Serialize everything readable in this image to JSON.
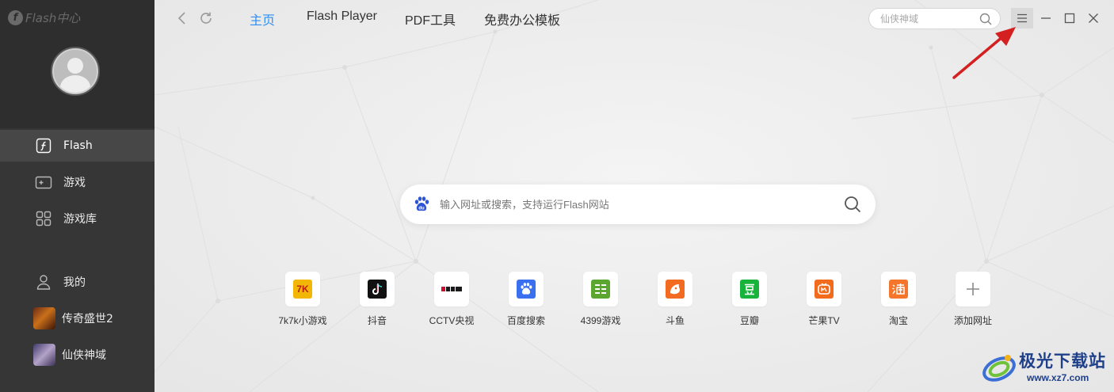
{
  "sidebar": {
    "logo_text": "Flash中心",
    "nav": [
      {
        "label": "Flash",
        "icon": "flash-icon",
        "active": true
      },
      {
        "label": "游戏",
        "icon": "gamepad-icon",
        "active": false
      },
      {
        "label": "游戏库",
        "icon": "grid-icon",
        "active": false
      }
    ],
    "mine": {
      "label": "我的",
      "icon": "user-icon"
    },
    "recent_games": [
      {
        "label": "传奇盛世2",
        "icon": "game-thumb-icon"
      },
      {
        "label": "仙侠神域",
        "icon": "game-thumb-icon"
      }
    ]
  },
  "topbar": {
    "tabs": [
      {
        "label": "主页",
        "active": true
      },
      {
        "label": "Flash Player",
        "active": false
      },
      {
        "label": "PDF工具",
        "active": false
      },
      {
        "label": "免费办公模板",
        "active": false
      }
    ],
    "search_placeholder": "仙侠神域"
  },
  "main": {
    "search_placeholder": "输入网址或搜索，支持运行Flash网站",
    "shortcuts": [
      {
        "label": "7k7k小游戏",
        "icon": "7k7k-icon",
        "color": "#f2b705"
      },
      {
        "label": "抖音",
        "icon": "douyin-icon",
        "color": "#111111"
      },
      {
        "label": "CCTV央视",
        "icon": "cctv-icon",
        "color": "#ffffff"
      },
      {
        "label": "百度搜索",
        "icon": "baidu-icon",
        "color": "#3a6ff0"
      },
      {
        "label": "4399游戏",
        "icon": "4399-icon",
        "color": "#5aa62e"
      },
      {
        "label": "斗鱼",
        "icon": "douyu-icon",
        "color": "#f36b21"
      },
      {
        "label": "豆瓣",
        "icon": "douban-icon",
        "color": "#17b33a"
      },
      {
        "label": "芒果TV",
        "icon": "mangotv-icon",
        "color": "#f26a1b"
      },
      {
        "label": "淘宝",
        "icon": "taobao-icon",
        "color": "#f5762a"
      },
      {
        "label": "添加网址",
        "icon": "plus-icon",
        "color": "#888888"
      }
    ]
  },
  "watermark": {
    "brand": "极光下载站",
    "url": "www.xz7.com"
  },
  "colors": {
    "accent": "#2e8ef2",
    "sidebar": "#363636",
    "arrow": "#d42020"
  }
}
